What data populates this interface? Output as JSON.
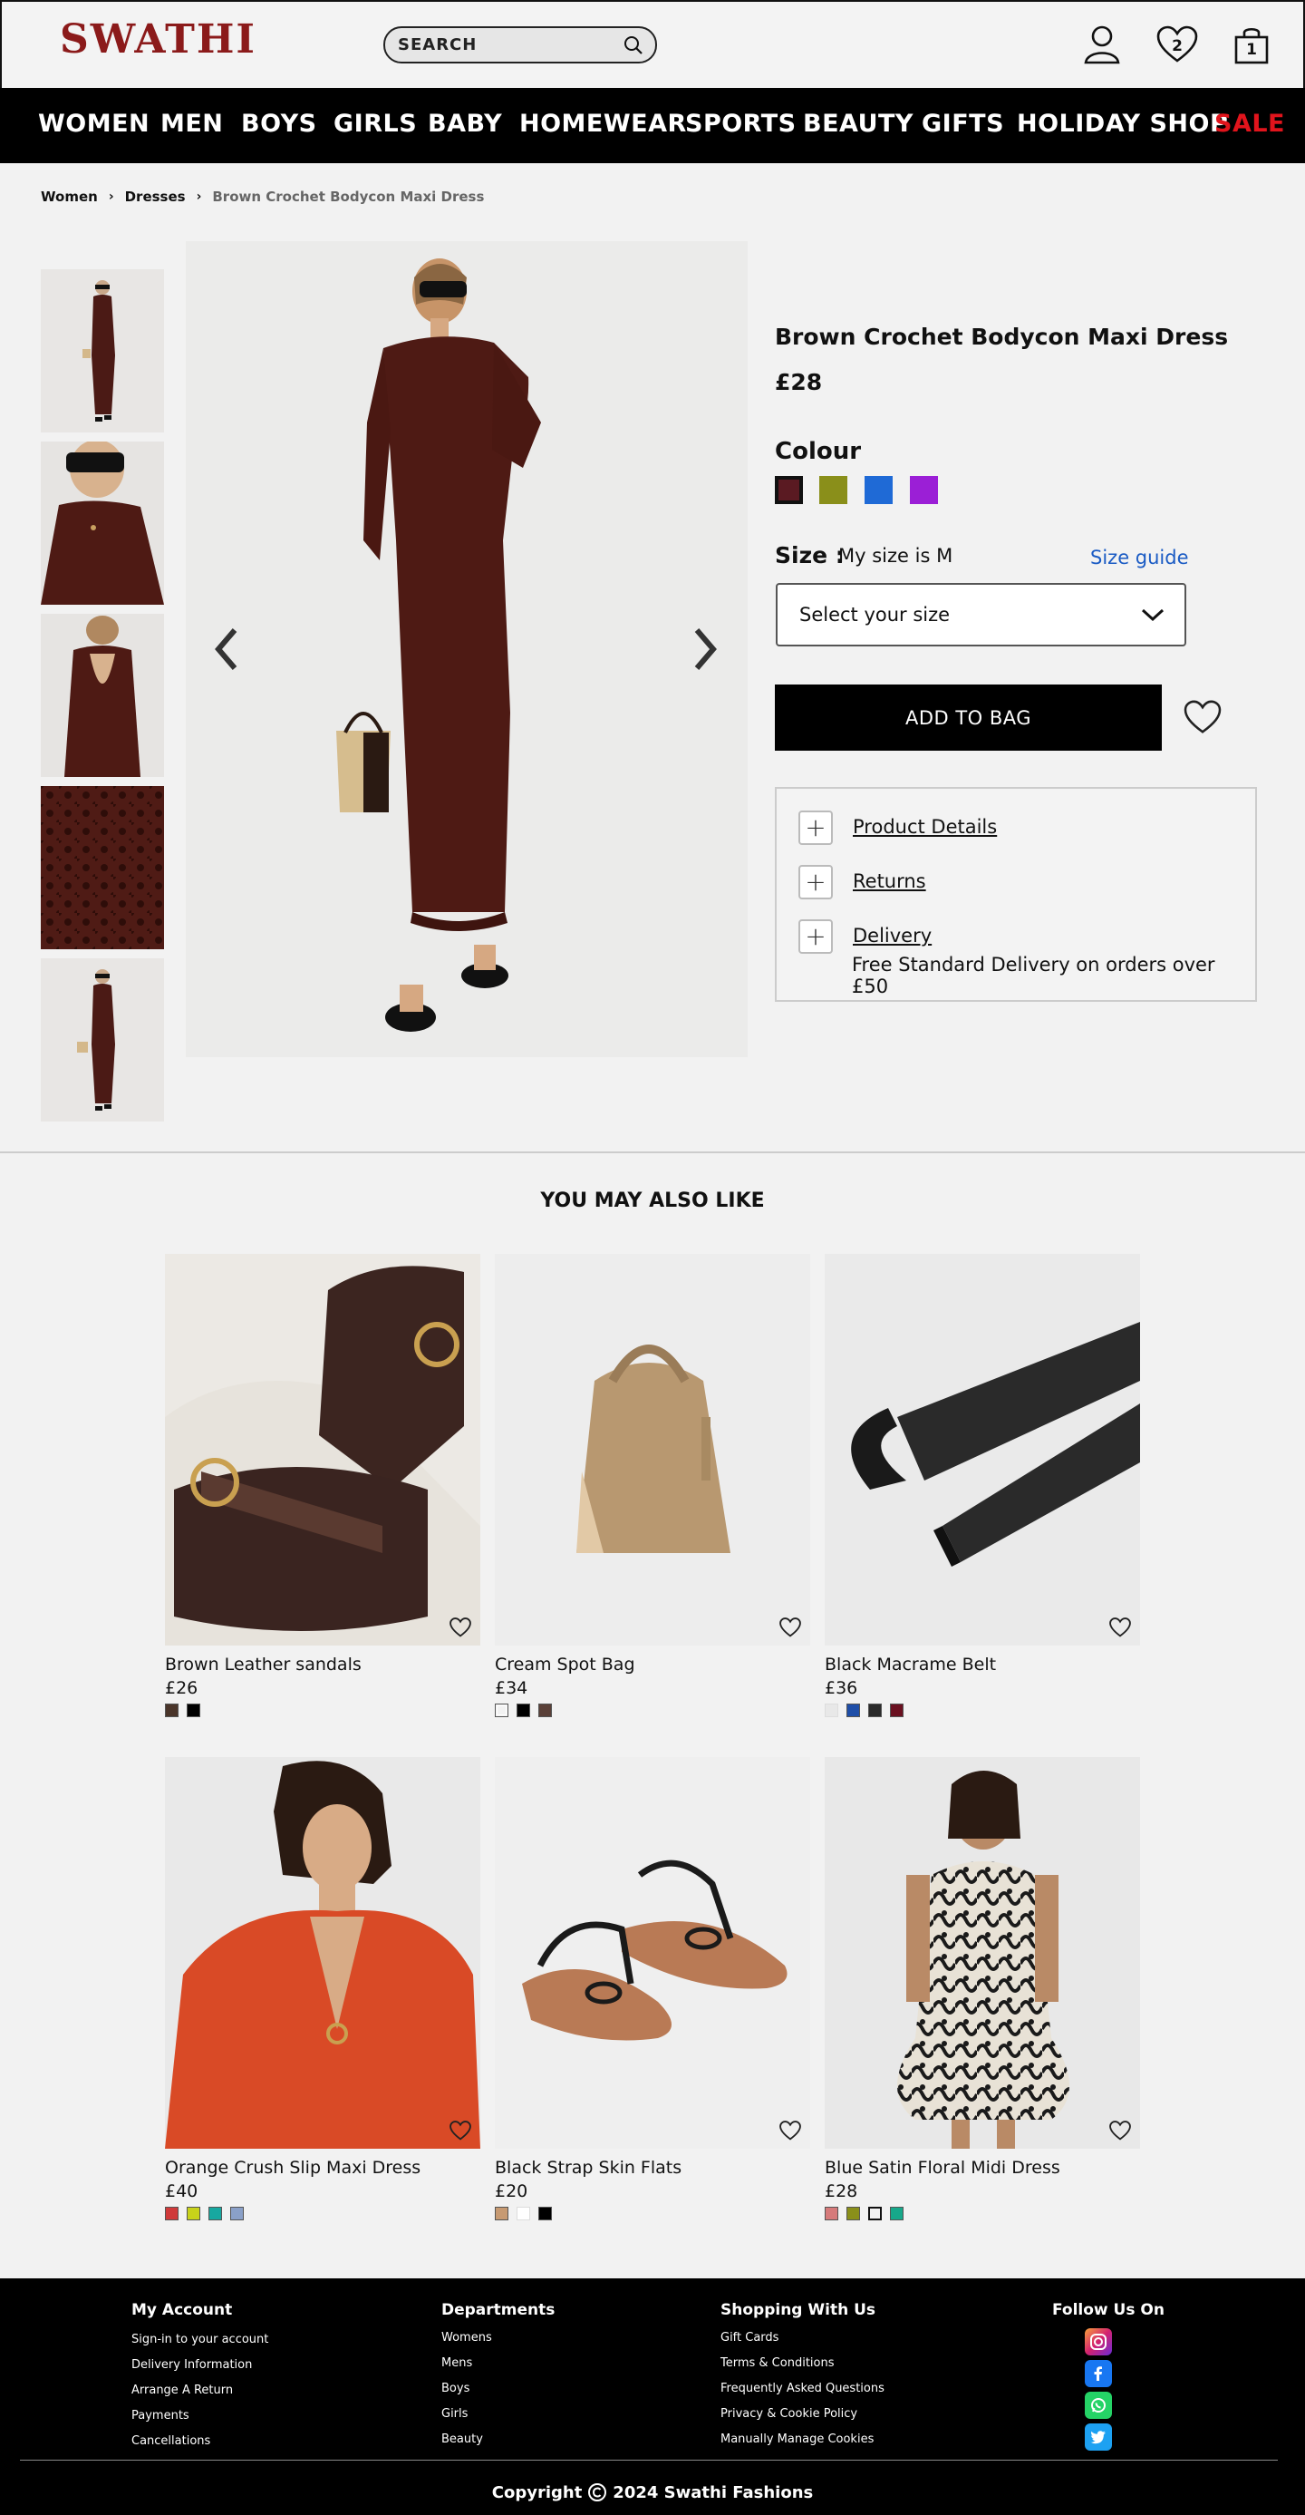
{
  "header": {
    "logo": "SWATHI",
    "search_label": "SEARCH",
    "wishlist_count": "2",
    "bag_count": "1"
  },
  "nav": [
    "WOMEN",
    "MEN",
    "BOYS",
    "GIRLS",
    "BABY",
    "HOMEWEAR",
    "SPORTS",
    "BEAUTY",
    "GIFTS",
    "HOLIDAY SHOP",
    "SALE"
  ],
  "breadcrumb": [
    "Women",
    "Dresses",
    "Brown Crochet Bodycon Maxi Dress"
  ],
  "product": {
    "title": "Brown Crochet Bodycon Maxi Dress",
    "price": "£28",
    "colour_label": "Colour",
    "colours": [
      "#5a1a22",
      "#8a8f1a",
      "#1f6ad6",
      "#9b1fd6"
    ],
    "size_label": "Size :",
    "my_size": "My size is M",
    "size_guide": "Size guide",
    "size_select": "Select your size",
    "add_to_bag": "ADD TO BAG",
    "accordion": [
      "Product Details",
      "Returns",
      "Delivery"
    ],
    "delivery_note": "Free Standard Delivery on orders over £50"
  },
  "recommendations": {
    "title": "YOU MAY ALSO LIKE",
    "items": [
      {
        "name": "Brown Leather sandals",
        "price": "£26",
        "swatches": [
          "#4a352a",
          "#000000"
        ]
      },
      {
        "name": "Cream Spot Bag",
        "price": "£34",
        "swatches": [
          "#f2f2f2",
          "#000000",
          "#5a4038"
        ]
      },
      {
        "name": "Black Macrame Belt",
        "price": "£36",
        "swatches": [
          "#e8e8e8",
          "#1e4ea8",
          "#2a2a2a",
          "#6a1020"
        ]
      },
      {
        "name": "Orange Crush Slip Maxi Dress",
        "price": "£40",
        "swatches": [
          "#d03a3a",
          "#c8d21a",
          "#17a8a0",
          "#8aa0c8"
        ]
      },
      {
        "name": "Black Strap Skin Flats",
        "price": "£20",
        "swatches": [
          "#c79a72",
          "#ffffff",
          "#000000"
        ]
      },
      {
        "name": "Blue Satin Floral Midi Dress",
        "price": "£28",
        "swatches": [
          "#d67a7a",
          "#8a8f1a",
          "#f2f2f2",
          "#17a88a"
        ]
      }
    ]
  },
  "footer": {
    "columns": [
      {
        "title": "My Account",
        "links": [
          "Sign-in to your account",
          "Delivery Information",
          "Arrange A Return",
          "Payments",
          "Cancellations"
        ]
      },
      {
        "title": "Departments",
        "links": [
          "Womens",
          "Mens",
          "Boys",
          "Girls",
          "Beauty"
        ]
      },
      {
        "title": "Shopping With Us",
        "links": [
          "Gift Cards",
          "Terms & Conditions",
          "Frequently Asked Questions",
          "Privacy & Cookie Policy",
          "Manually Manage Cookies"
        ]
      },
      {
        "title": "Follow Us On",
        "links": []
      }
    ],
    "copyright_prefix": "Copyright",
    "copyright_suffix": "2024 Swathi Fashions"
  }
}
